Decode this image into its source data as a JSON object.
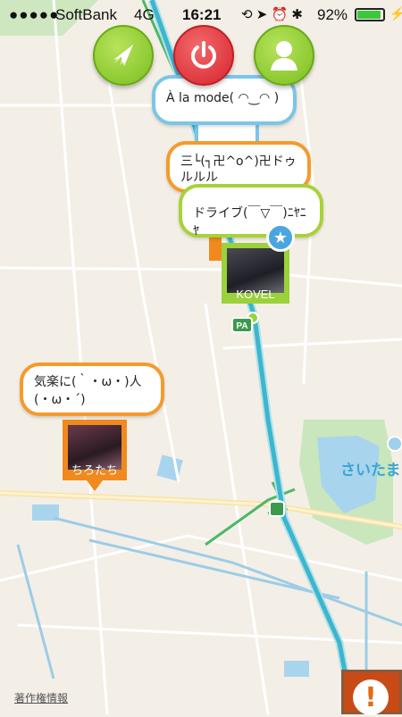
{
  "status_bar": {
    "signal": "●●●●●",
    "carrier": "SoftBank",
    "network": "4G",
    "time": "16:21",
    "battery_percent": "92%",
    "battery_level": 0.92,
    "icons": [
      "rotation-lock-icon",
      "location-arrow-icon",
      "alarm-icon",
      "bluetooth-icon"
    ]
  },
  "toolbar": {
    "left_icon": "navigation-arrow-icon",
    "center_icon": "power-icon",
    "right_icon": "user-profile-icon",
    "colors": {
      "green": "#8fcf2a",
      "red": "#e0303a"
    }
  },
  "posts": [
    {
      "text": "À la mode( ◠‿◠ )",
      "border_color": "#7ac5ea"
    },
    {
      "text": "三└(┐卍^o^)卍ドゥルルル",
      "border_color": "#f59a2c"
    },
    {
      "text": "ドライブ(￣▽￣)ﾆﾔﾆﾔ",
      "border_color": "#a8d238"
    },
    {
      "text": "気楽に(｀・ω・)人(・ω・´)",
      "border_color": "#f59a2c"
    }
  ],
  "photos": [
    {
      "label": "KOVEL",
      "frame_color": "#9bd13a"
    },
    {
      "label": "ちろたち",
      "frame_color": "#f08a1e"
    }
  ],
  "map": {
    "place_label": "さいたま",
    "road_sign": "PA",
    "route_color": "#3ab7cf",
    "copyright": "著作権情報"
  },
  "alert_button": {
    "icon": "exclamation-icon",
    "symbol": "!"
  }
}
